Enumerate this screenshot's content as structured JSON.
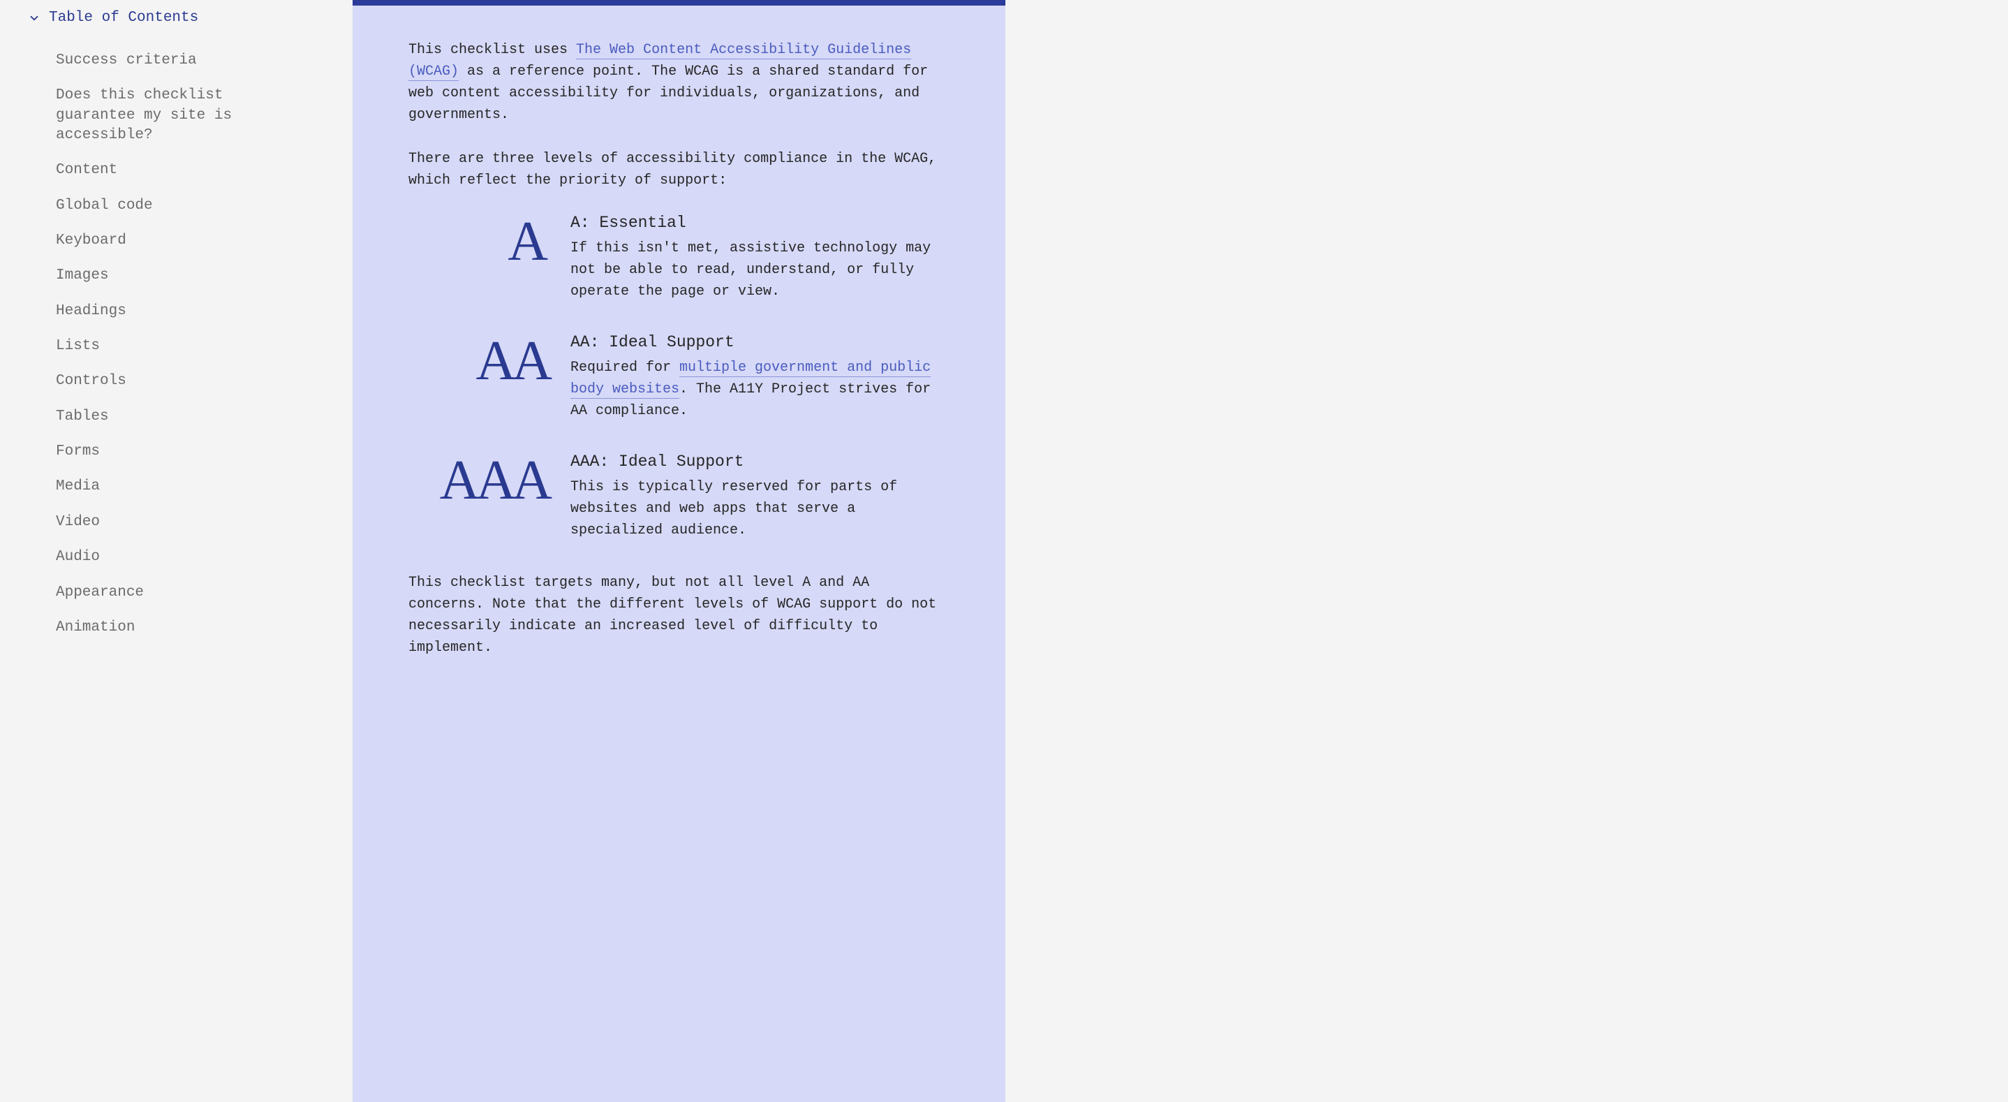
{
  "toc": {
    "header": "Table of Contents",
    "items": [
      "Success criteria",
      "Does this checklist guarantee my site is accessible?",
      "Content",
      "Global code",
      "Keyboard",
      "Images",
      "Headings",
      "Lists",
      "Controls",
      "Tables",
      "Forms",
      "Media",
      "Video",
      "Audio",
      "Appearance",
      "Animation"
    ]
  },
  "intro": {
    "p1_a": "This checklist uses ",
    "p1_link": "The Web Content Accessibility Guidelines (WCAG)",
    "p1_b": " as a reference point. The WCAG is a shared standard for web content accessibility for individuals, organizations, and governments.",
    "p2": "There are three levels of accessibility compliance in the WCAG, which reflect the priority of support:"
  },
  "levels": {
    "a": {
      "badge": "A",
      "title": "A: Essential",
      "desc": "If this isn't met, assistive technology may not be able to read, understand, or fully operate the page or view."
    },
    "aa": {
      "badge": "AA",
      "title": "AA: Ideal Support",
      "desc_a": "Required for ",
      "desc_link": "multiple government and public body websites",
      "desc_b": ". The A11Y Project strives for AA compliance."
    },
    "aaa": {
      "badge": "AAA",
      "title": "AAA: Ideal Support",
      "desc": "This is typically reserved for parts of websites and web apps that serve a specialized audience."
    }
  },
  "outro": {
    "p1": "This checklist targets many, but not all level A and AA concerns. Note that the different levels of WCAG support do not necessarily indicate an increased level of difficulty to implement."
  }
}
